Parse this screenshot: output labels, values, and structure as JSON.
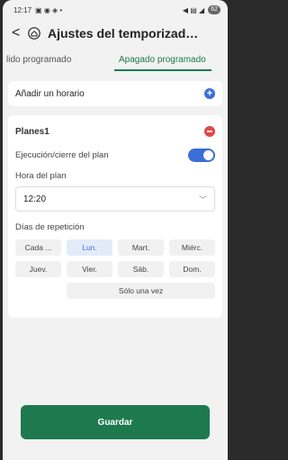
{
  "status": {
    "time": "12:17",
    "battery": "62"
  },
  "header": {
    "title": "Ajustes del temporizad…"
  },
  "tabs": [
    {
      "label": "lido programado"
    },
    {
      "label": "Apagado programado"
    }
  ],
  "add": {
    "label": "Añadir un horario"
  },
  "plan": {
    "name": "Planes1",
    "exec_label": "Ejecución/cierre del plan",
    "time_label": "Hora del plan",
    "time_value": "12:20",
    "days_label": "Días de repetición",
    "days": [
      "Cada ...",
      "Lun.",
      "Mart.",
      "Miérc.",
      "Juev.",
      "Vier.",
      "Sáb.",
      "Dom."
    ],
    "once": "Sólo una vez"
  },
  "save_label": "Guardar"
}
